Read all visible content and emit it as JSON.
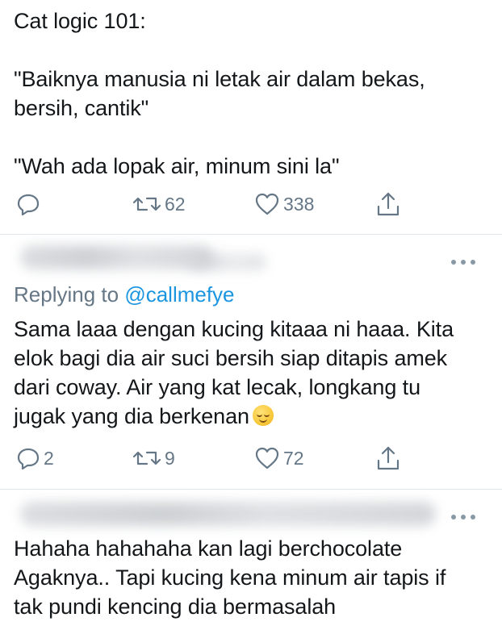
{
  "tweet1": {
    "line1": "Cat logic 101:",
    "line2": "\"Baiknya manusia ni letak air dalam bekas, bersih, cantik\"",
    "line3": "\"Wah ada lopak air, minum sini la\"",
    "actions": {
      "reply_count": "",
      "retweet_count": "62",
      "like_count": "338"
    }
  },
  "reply1": {
    "replying_prefix": "Replying to ",
    "replying_handle": "@callmefye",
    "text": "Sama laaa dengan kucing kitaaa ni haaa. Kita elok bagi dia air suci bersih siap ditapis amek dari coway. Air yang kat lecak, longkang tu jugak yang dia berkenan",
    "emoji": "relieved-face",
    "actions": {
      "reply_count": "2",
      "retweet_count": "9",
      "like_count": "72"
    }
  },
  "reply2": {
    "text": "Hahaha hahahaha kan lagi berchocolate Agaknya.. Tapi kucing kena minum air tapis if tak pundi kencing dia bermasalah"
  },
  "colors": {
    "text": "#14171a",
    "muted": "#657786",
    "link": "#1b95e0",
    "divider": "#e1e8ed"
  }
}
